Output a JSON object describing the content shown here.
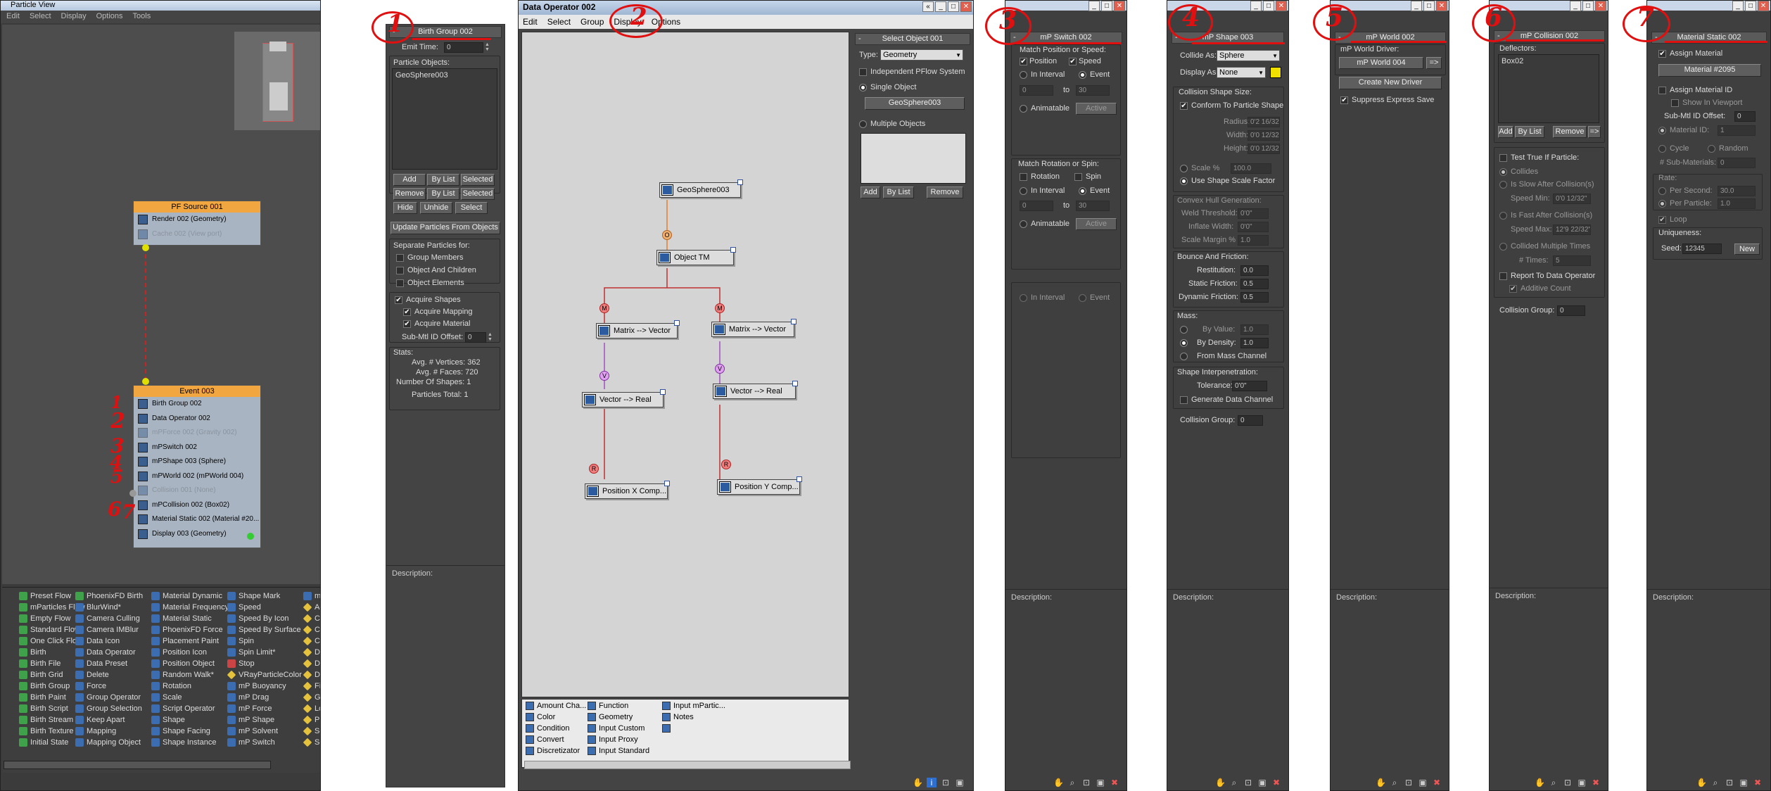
{
  "particle_view": {
    "title": "Particle View",
    "menu": [
      "Edit",
      "Select",
      "Display",
      "Options",
      "Tools"
    ],
    "birth_group_title": "Birth Group 002",
    "emit_time_label": "Emit Time:",
    "emit_time_value": "0",
    "particle_objects_label": "Particle Objects:",
    "particle_objects": [
      "GeoSphere003"
    ],
    "btn_add": "Add",
    "btn_bylist": "By List",
    "btn_selected": "Selected",
    "btn_remove": "Remove",
    "btn_bylist2": "By List",
    "btn_selected2": "Selected",
    "btn_hide": "Hide",
    "btn_unhide": "Unhide",
    "btn_select": "Select",
    "btn_update": "Update Particles From Objects",
    "separate_label": "Separate Particles for:",
    "sep_options": [
      "Group Members",
      "Object And Children",
      "Object Elements"
    ],
    "acquire_shapes": "Acquire Shapes",
    "acquire_mapping": "Acquire Mapping",
    "acquire_material": "Acquire Material",
    "submtl_label": "Sub-Mtl ID Offset:",
    "submtl_value": "0",
    "stats_label": "Stats:",
    "avg_vertices": "Avg. # Vertices: 362",
    "avg_faces": "Avg. # Faces: 720",
    "num_shapes": "Number Of Shapes: 1",
    "particles_total": "Particles Total: 1",
    "description_label": "Description:",
    "pf_source": {
      "title": "PF Source 001",
      "rows": [
        "Render 002 (Geometry)",
        "Cache 002 (View port)"
      ]
    },
    "event": {
      "title": "Event 003",
      "rows": [
        {
          "text": "Birth Group 002",
          "disabled": false
        },
        {
          "text": "Data Operator 002",
          "disabled": false
        },
        {
          "text": "mPForce 002 (Gravity 002)",
          "disabled": true
        },
        {
          "text": "mPSwitch  002",
          "disabled": false
        },
        {
          "text": "mPShape 003 (Sphere)",
          "disabled": false
        },
        {
          "text": "mPWorld 002 (mPWorld 004)",
          "disabled": false
        },
        {
          "text": "Collision 001 (None)",
          "disabled": true
        },
        {
          "text": "mPCollision 002 (Box02)",
          "disabled": false
        },
        {
          "text": "Material Static 002 (Material #20...",
          "disabled": false
        },
        {
          "text": "Display 003 (Geometry)",
          "disabled": false
        }
      ]
    },
    "depot": [
      [
        "Preset Flow",
        "mParticles Flow",
        "Empty Flow",
        "Standard Flow",
        "One Click Flow",
        "Birth",
        "Birth File",
        "Birth Grid",
        "Birth Group",
        "Birth Paint",
        "Birth Script",
        "Birth Stream",
        "Birth Texture",
        "Initial State"
      ],
      [
        "PhoenixFD Birth",
        "BlurWind*",
        "Camera Culling",
        "Camera IMBlur",
        "Data Icon",
        "Data Operator",
        "Data Preset",
        "Delete",
        "Force",
        "Group Operator",
        "Group Selection",
        "Keep Apart",
        "Mapping",
        "Mapping Object"
      ],
      [
        "Material Dynamic",
        "Material Frequency",
        "Material Static",
        "PhoenixFD Force",
        "Placement Paint",
        "Position Icon",
        "Position Object",
        "Random Walk*",
        "Rotation",
        "Scale",
        "Script Operator",
        "Shape",
        "Shape Facing",
        "Shape Instance"
      ],
      [
        "Shape Mark",
        "Speed",
        "Speed By Icon",
        "Speed By Surface",
        "Spin",
        "Spin Limit*",
        "Stop",
        "VRayParticleColor",
        "mP Buoyancy",
        "mP Drag",
        "mP Force",
        "mP Shape",
        "mP Solvent",
        "mP Switch"
      ],
      [
        "mP World",
        "Age Test",
        "Collision",
        "Collision Spawn",
        "Copy Out",
        "Data Icon Test",
        "Data Preset",
        "Data Test",
        "Find Target",
        "Go To Rotation",
        "Lock/Bond",
        "PhoenixFD Test",
        "Scale Test",
        "Script Test"
      ]
    ],
    "hand_numbers": [
      "1",
      "2",
      "3",
      "4",
      "5",
      "6",
      "7"
    ]
  },
  "data_operator": {
    "title": "Data Operator 002",
    "menu": [
      "Edit",
      "Select",
      "Group",
      "Display",
      "Options"
    ],
    "nodes": {
      "geosphere": "GeoSphere003",
      "objecttm": "Object TM",
      "mv1": "Matrix --> Vector",
      "mv2": "Matrix --> Vector",
      "vr1": "Vector --> Real",
      "vr2": "Vector --> Real",
      "px": "Position X Comp...",
      "py": "Position Y Comp..."
    },
    "conn_labels": {
      "o": "O",
      "m1": "M",
      "m2": "M",
      "v1": "V",
      "v2": "V",
      "r1": "R",
      "r2": "R"
    },
    "select_object_title": "Select Object 001",
    "type_label": "Type:",
    "type_value": "Geometry",
    "independent": "Independent PFlow System",
    "single_object": "Single Object",
    "single_object_btn": "GeoSphere003",
    "multiple_objects": "Multiple Objects",
    "btn_add": "Add",
    "btn_bylist": "By List",
    "btn_remove": "Remove",
    "categories": [
      [
        "Amount Cha...",
        "Color",
        "Condition",
        "Convert",
        "Discretizator"
      ],
      [
        "Function",
        "Geometry",
        "Input Custom",
        "Input Proxy",
        "Input Standard"
      ],
      [
        "Input mPartic...",
        "Notes",
        ""
      ]
    ]
  },
  "mp_switch": {
    "title": "mP Switch  002",
    "match_pos": "Match Position or Speed:",
    "position": "Position",
    "speed": "Speed",
    "in_interval": "In Interval",
    "event": "Event",
    "from": "0",
    "to_label": "to",
    "to": "30",
    "animatable": "Animatable",
    "active": "Active",
    "match_rot": "Match Rotation or Spin:",
    "rotation": "Rotation",
    "spin": "Spin",
    "in_interval2": "In Interval",
    "event2": "Event",
    "from2": "0",
    "to2": "30",
    "animatable2": "Animatable",
    "active2": "Active",
    "in_interval3": "In Interval",
    "event3": "Event",
    "description_label": "Description:"
  },
  "mp_shape": {
    "title": "mP Shape 003",
    "collide_as": "Collide As:",
    "collide_value": "Sphere",
    "display_as": "Display As:",
    "display_value": "None",
    "swatch_color": "#f0e000",
    "collision_size": "Collision Shape Size:",
    "conform": "Conform To Particle Shape",
    "radius_l": "Radius:",
    "radius": "0'2 16/32\"",
    "width_l": "Width:",
    "width": "0'0 12/32\"",
    "height_l": "Height:",
    "height": "0'0 12/32\"",
    "scale_l": "Scale %",
    "scale": "100.0",
    "use_scale": "Use Shape Scale Factor",
    "convex": "Convex Hull Generation:",
    "weld_l": "Weld Threshold:",
    "weld": "0'0\"",
    "inflate_l": "Inflate Width:",
    "inflate": "0'0\"",
    "margin_l": "Scale Margin %",
    "margin": "1.0",
    "bounce": "Bounce And Friction:",
    "restitution_l": "Restitution:",
    "restitution": "0.0",
    "static_l": "Static Friction:",
    "static": "0.5",
    "dynamic_l": "Dynamic Friction:",
    "dynamic": "0.5",
    "mass": "Mass:",
    "by_value": "By Value:",
    "by_value_v": "1.0",
    "by_density": "By Density:",
    "by_density_v": "1.0",
    "from_mass": "From Mass Channel",
    "interp": "Shape Interpenetration:",
    "tolerance_l": "Tolerance:",
    "tolerance": "0'0\"",
    "gen_data": "Generate Data Channel",
    "coll_group_l": "Collision Group:",
    "coll_group": "0",
    "description_label": "Description:"
  },
  "mp_world": {
    "title": "mP World 002",
    "driver_label": "mP World Driver:",
    "driver_btn": "mP World 004",
    "arrow": "=>",
    "create_btn": "Create New Driver",
    "suppress": "Suppress Express Save",
    "description_label": "Description:"
  },
  "mp_collision": {
    "title": "mP Collision 002",
    "deflectors": "Deflectors:",
    "deflector_items": [
      "Box02"
    ],
    "btn_add": "Add",
    "btn_bylist": "By List",
    "btn_remove": "Remove",
    "btn_arrow": "=>",
    "test_true": "Test True If Particle:",
    "collides": "Collides",
    "slow": "Is Slow After Collision(s)",
    "speed_min_l": "Speed Min:",
    "speed_min": "0'0 12/32\"",
    "fast": "Is Fast After Collision(s)",
    "speed_max_l": "Speed Max:",
    "speed_max": "12'9 22/32\"",
    "multiple": "Collided Multiple Times",
    "times_l": "# Times:",
    "times": "5",
    "report": "Report To Data Operator",
    "additive": "Additive Count",
    "coll_group_l": "Collision Group:",
    "coll_group": "0",
    "description_label": "Description:"
  },
  "material_static": {
    "title": "Material Static 002",
    "assign_material": "Assign Material",
    "material_btn": "Material #2095",
    "assign_id": "Assign Material ID",
    "show_vp": "Show In Viewport",
    "submtl_l": "Sub-Mtl ID Offset:",
    "submtl": "0",
    "matid_l": "Material ID:",
    "matid": "1",
    "cycle": "Cycle",
    "random": "Random",
    "num_sub_l": "# Sub-Materials:",
    "num_sub": "0",
    "rate": "Rate:",
    "per_second": "Per Second:",
    "per_second_v": "30.0",
    "per_particle": "Per Particle:",
    "per_particle_v": "1.0",
    "loop": "Loop",
    "uniqueness": "Uniqueness:",
    "seed_l": "Seed:",
    "seed": "12345",
    "new_btn": "New",
    "description_label": "Description:"
  }
}
